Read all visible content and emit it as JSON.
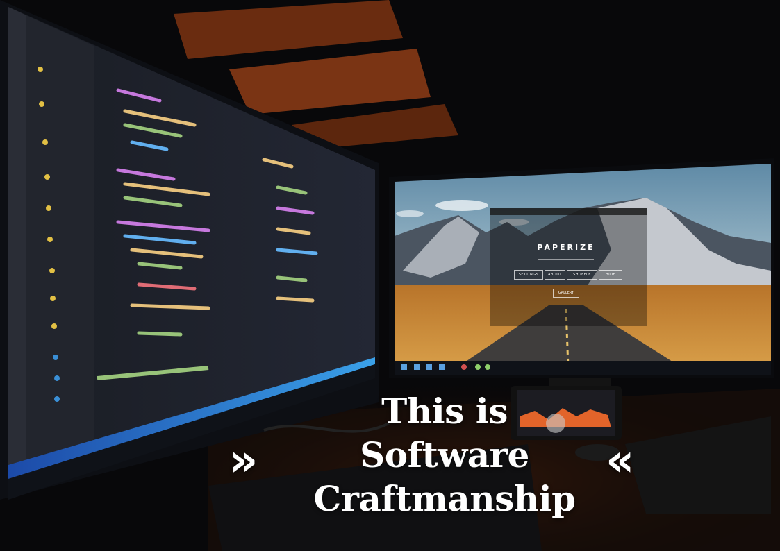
{
  "headline": {
    "line1": "This is",
    "line2": "Software",
    "line3": "Craftmanship",
    "chevron_left": "»",
    "chevron_right": "«"
  },
  "monitor_app": {
    "title": "PAPERIZE",
    "buttons": [
      "SETTINGS",
      "ABOUT",
      "SHUFFLE",
      "HIDE"
    ],
    "gallery_label": "GALLERY"
  },
  "colors": {
    "background": "#0b0b0d",
    "code_bg": "#1e2129",
    "sky": "#7fa6be",
    "desert": "#c98a3a",
    "taskbar": "#0f1218",
    "headline_text": "#ffffff",
    "ambient_orange": "#c0581f"
  }
}
